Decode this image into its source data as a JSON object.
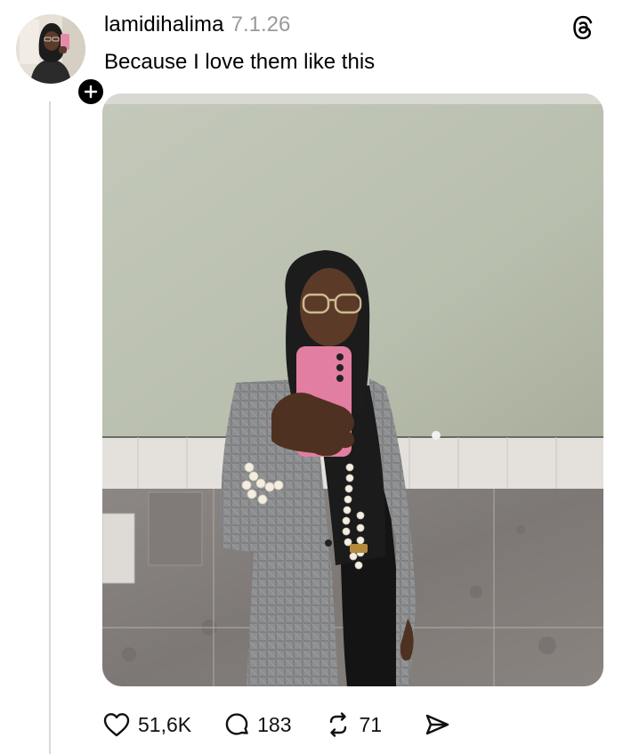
{
  "post": {
    "username": "lamidihalima",
    "date": "7.1.26",
    "text": "Because I love them like this"
  },
  "actions": {
    "likes": "51,6K",
    "replies": "183",
    "reposts": "71"
  },
  "icons": {
    "app_logo": "threads-icon",
    "follow": "plus-icon",
    "like": "heart-icon",
    "reply": "comment-icon",
    "repost": "repost-icon",
    "share": "send-icon"
  }
}
